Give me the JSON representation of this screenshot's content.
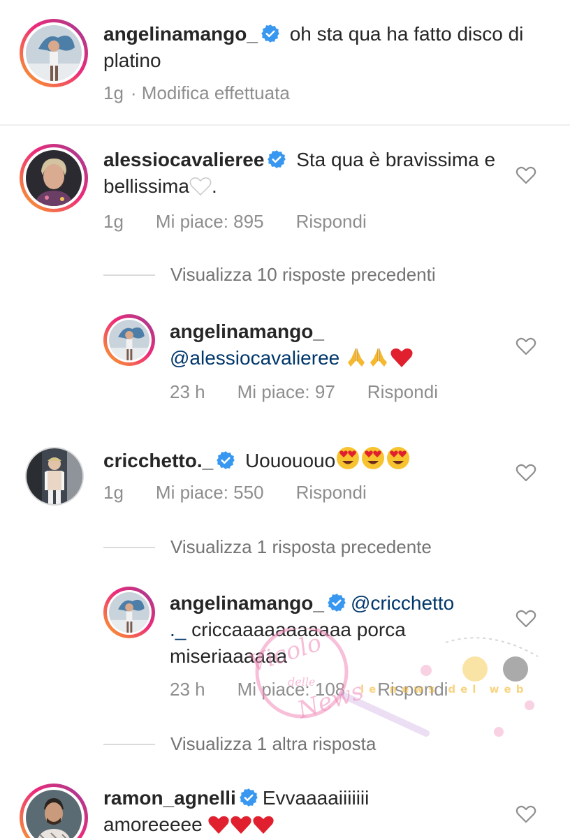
{
  "comments": [
    {
      "username": "angelinamango_",
      "text": "oh sta qua ha fatto disco di platino",
      "time": "1g",
      "edited": "· Modifica effettuata"
    },
    {
      "username": "alessiocavalieree",
      "text": "Sta qua è bravissima e bellissima",
      "text_suffix": ".",
      "time": "1g",
      "likes": "Mi piace: 895",
      "reply": "Rispondi",
      "view_replies": "Visualizza 10 risposte precedenti"
    },
    {
      "username": "angelinamango_",
      "mention": "@alessiocavalieree",
      "time": "23 h",
      "likes": "Mi piace: 97",
      "reply": "Rispondi"
    },
    {
      "username": "cricchetto._",
      "text": "Uouououo",
      "time": "1g",
      "likes": "Mi piace: 550",
      "reply": "Rispondi",
      "view_replies": "Visualizza 1 risposta precedente"
    },
    {
      "username": "angelinamango_",
      "mention_line1": "@cricchetto",
      "mention_line2": "._",
      "text_line2": " criccaaaaaaaaaaa porca",
      "text_line3": "miseriaaaaaa",
      "time": "23 h",
      "likes": "Mi piace: 108",
      "reply": "Rispondi",
      "view_replies": "Visualizza 1 altra risposta"
    },
    {
      "username": "ramon_agnelli",
      "text_line1": "Evvaaaaiiiiiii",
      "text_line2": "amoreeeee"
    }
  ],
  "watermark": {
    "line1": "Vicolo",
    "line2": "delle",
    "line3": "News",
    "tagline": "le news del web"
  },
  "colors": {
    "text": "#262626",
    "meta": "#8e8e8e",
    "verified": "#3897f0",
    "mention": "#00376b",
    "divider": "#efefef"
  },
  "icons": [
    "verified-badge-icon",
    "heart-outline-icon",
    "white-heart-emoji",
    "folded-hands-emoji",
    "red-heart-emoji",
    "heart-eyes-emoji"
  ]
}
